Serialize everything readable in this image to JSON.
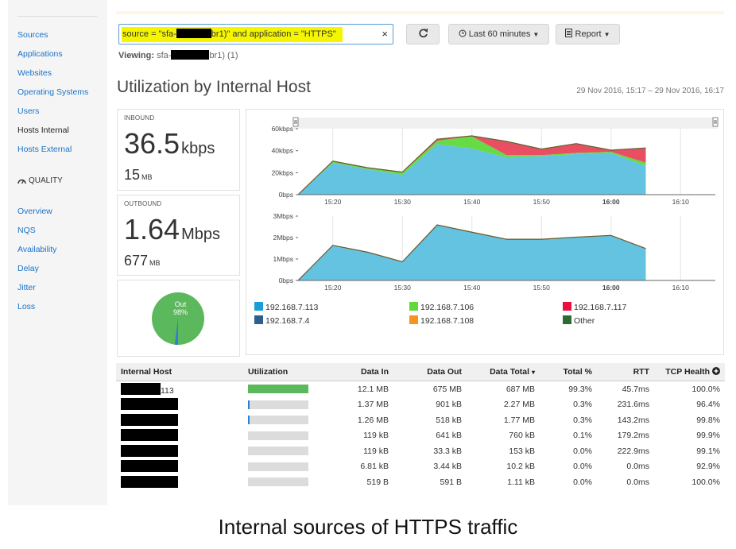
{
  "sidebar": {
    "items": [
      "Sources",
      "Applications",
      "Websites",
      "Operating Systems",
      "Users",
      "Hosts Internal",
      "Hosts External"
    ],
    "active": "Hosts Internal",
    "section_label": "QUALITY",
    "quality_items": [
      "Overview",
      "NQS",
      "Availability",
      "Delay",
      "Jitter",
      "Loss"
    ]
  },
  "search": {
    "prefix": "source = \"sfa-",
    "suffix": "br1)\" and application = \"HTTPS\"",
    "clear_label": "×"
  },
  "toolbar": {
    "timerange_label": "Last 60 minutes",
    "report_label": "Report"
  },
  "viewing": {
    "label": "Viewing:",
    "prefix": "sfa-",
    "suffix": "br1) (1)"
  },
  "page_title": "Utilization by Internal Host",
  "date_range": "29 Nov 2016, 15:17 – 29 Nov 2016, 16:17",
  "inbound": {
    "label": "INBOUND",
    "rate_value": "36.5",
    "rate_unit": "kbps",
    "total_value": "15",
    "total_unit": "MB"
  },
  "outbound": {
    "label": "OUTBOUND",
    "rate_value": "1.64",
    "rate_unit": "Mbps",
    "total_value": "677",
    "total_unit": "MB"
  },
  "pie": {
    "label": "Out",
    "percent": "98%",
    "out_fraction": 0.98
  },
  "colors": {
    "host113": "#5bc0de",
    "host106": "#5ed93a",
    "host117": "#e8455a",
    "host4": "#2c5f8f",
    "host108": "#f7941d",
    "other": "#2e6b34"
  },
  "chart_data": [
    {
      "type": "area",
      "ylabel": "",
      "y_ticks": [
        "0bps",
        "20kbps",
        "40kbps",
        "60kbps"
      ],
      "x_ticks": [
        "15:20",
        "15:30",
        "15:40",
        "15:50",
        "16:00",
        "16:10"
      ],
      "ylim": [
        0,
        60000
      ],
      "x": [
        "15:15",
        "15:20",
        "15:25",
        "15:30",
        "15:35",
        "15:40",
        "15:45",
        "15:50",
        "15:55",
        "16:00",
        "16:05"
      ],
      "series": [
        {
          "name": "192.168.7.113",
          "values": [
            0,
            29000,
            23000,
            18000,
            46000,
            42000,
            34000,
            35000,
            37000,
            38000,
            26000
          ]
        },
        {
          "name": "192.168.7.106",
          "values": [
            0,
            1000,
            1000,
            2000,
            3000,
            11000,
            2000,
            1000,
            1000,
            1000,
            3000
          ]
        },
        {
          "name": "192.168.7.117",
          "values": [
            0,
            0,
            0,
            0,
            1000,
            0,
            12000,
            5000,
            8000,
            1000,
            13000
          ]
        },
        {
          "name": "Other",
          "values": [
            0,
            500,
            500,
            500,
            500,
            500,
            500,
            500,
            500,
            500,
            500
          ]
        }
      ]
    },
    {
      "type": "area",
      "y_ticks": [
        "0bps",
        "1Mbps",
        "2Mbps",
        "3Mbps"
      ],
      "x_ticks": [
        "15:20",
        "15:30",
        "15:40",
        "15:50",
        "16:00",
        "16:10"
      ],
      "ylim": [
        0,
        3000000
      ],
      "x": [
        "15:15",
        "15:20",
        "15:25",
        "15:30",
        "15:35",
        "15:40",
        "15:45",
        "15:50",
        "15:55",
        "16:00",
        "16:05"
      ],
      "series": [
        {
          "name": "192.168.7.113",
          "values": [
            0,
            1620000,
            1300000,
            850000,
            2570000,
            2230000,
            1900000,
            1900000,
            2000000,
            2080000,
            1470000
          ]
        },
        {
          "name": "Other",
          "values": [
            0,
            20000,
            20000,
            20000,
            20000,
            20000,
            20000,
            20000,
            20000,
            20000,
            20000
          ]
        }
      ]
    }
  ],
  "legend": [
    {
      "name": "192.168.7.113",
      "color": "#1a9ed8"
    },
    {
      "name": "192.168.7.106",
      "color": "#5ed93a"
    },
    {
      "name": "192.168.7.117",
      "color": "#e8113d"
    },
    {
      "name": "192.168.7.4",
      "color": "#2c5f8f"
    },
    {
      "name": "192.168.7.108",
      "color": "#f7941d"
    },
    {
      "name": "Other",
      "color": "#2e6b34"
    }
  ],
  "table": {
    "columns": [
      "Internal Host",
      "Utilization",
      "Data In",
      "Data Out",
      "Data Total",
      "Total %",
      "RTT",
      "TCP Health"
    ],
    "sort_indicator": "▾",
    "rows": [
      {
        "host": "113",
        "util": 1.0,
        "in": "12.1 MB",
        "out": "675 MB",
        "total": "687 MB",
        "pct": "99.3%",
        "rtt": "45.7ms",
        "tcp": "100.0%"
      },
      {
        "host": "",
        "util": 0.01,
        "in": "1.37 MB",
        "out": "901 kB",
        "total": "2.27 MB",
        "pct": "0.3%",
        "rtt": "231.6ms",
        "tcp": "96.4%"
      },
      {
        "host": "",
        "util": 0.01,
        "in": "1.26 MB",
        "out": "518 kB",
        "total": "1.77 MB",
        "pct": "0.3%",
        "rtt": "143.2ms",
        "tcp": "99.8%"
      },
      {
        "host": "",
        "util": 0,
        "in": "119 kB",
        "out": "641 kB",
        "total": "760 kB",
        "pct": "0.1%",
        "rtt": "179.2ms",
        "tcp": "99.9%"
      },
      {
        "host": "",
        "util": 0,
        "in": "119 kB",
        "out": "33.3 kB",
        "total": "153 kB",
        "pct": "0.0%",
        "rtt": "222.9ms",
        "tcp": "99.1%"
      },
      {
        "host": "",
        "util": 0,
        "in": "6.81 kB",
        "out": "3.44 kB",
        "total": "10.2 kB",
        "pct": "0.0%",
        "rtt": "0.0ms",
        "tcp": "92.9%"
      },
      {
        "host": "",
        "util": 0,
        "in": "519 B",
        "out": "591 B",
        "total": "1.11 kB",
        "pct": "0.0%",
        "rtt": "0.0ms",
        "tcp": "100.0%"
      }
    ]
  },
  "caption": "Internal sources of HTTPS traffic"
}
